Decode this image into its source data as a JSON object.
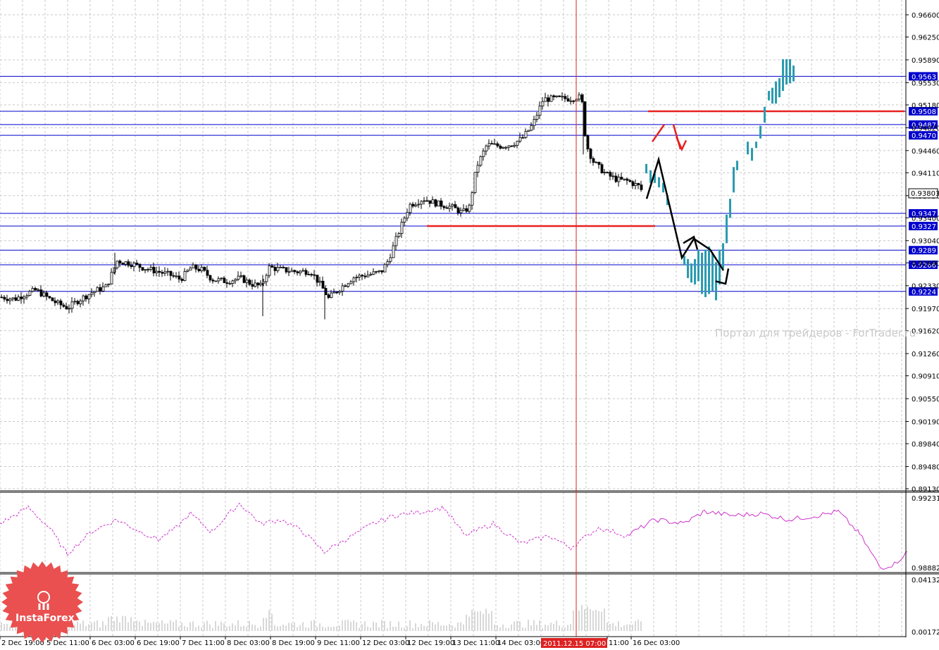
{
  "watermark": "Портал для трейдеров - ForTrader.ru",
  "brand": {
    "name": "InstaForex",
    "color": "#e9504f"
  },
  "current_price": "0.93803",
  "cursor_time": "2011.12.15 07:00",
  "colors": {
    "support_resistance": "#0000cc",
    "forecast_line": "#e82020",
    "forecast_bars": "#2a9bb0",
    "zigzag": "#000000",
    "oscillator": "#cc33cc",
    "cursor": "#dd2222",
    "grid": "#c8c8c8"
  },
  "chart_data": [
    {
      "type": "candlestick",
      "panel": "price",
      "y_ticks": [
        "0.96600",
        "0.96250",
        "0.95890",
        "0.95530",
        "0.95180",
        "0.94820",
        "0.94460",
        "0.94110",
        "0.93750",
        "0.93400",
        "0.93040",
        "0.92690",
        "0.92330",
        "0.91970",
        "0.91620",
        "0.91260",
        "0.90910",
        "0.90550",
        "0.90190",
        "0.89840",
        "0.89480",
        "0.89130"
      ],
      "ylim": [
        0.8913,
        0.966
      ],
      "x_ticks": [
        "2 Dec 19:00",
        "5 Dec 11:00",
        "6 Dec 03:00",
        "6 Dec 19:00",
        "7 Dec 11:00",
        "8 Dec 03:00",
        "8 Dec 19:00",
        "9 Dec 11:00",
        "12 Dec 03:00",
        "12 Dec 19:00",
        "13 Dec 11:00",
        "14 Dec 03:00",
        "11:00",
        "16 Dec 03:00"
      ],
      "levels": [
        {
          "label": "0.9563",
          "value": 0.9563
        },
        {
          "label": "0.9508",
          "value": 0.9508
        },
        {
          "label": "0.9487",
          "value": 0.9487
        },
        {
          "label": "0.9470",
          "value": 0.947
        },
        {
          "label": "0.9347",
          "value": 0.9347
        },
        {
          "label": "0.9327",
          "value": 0.9327
        },
        {
          "label": "0.9289",
          "value": 0.9289
        },
        {
          "label": "0.9266",
          "value": 0.9266
        },
        {
          "label": "0.9224",
          "value": 0.9224
        }
      ],
      "price_path": [
        [
          0,
          0.9215
        ],
        [
          20,
          0.9212
        ],
        [
          35,
          0.922
        ],
        [
          50,
          0.9226
        ],
        [
          65,
          0.9215
        ],
        [
          80,
          0.9205
        ],
        [
          95,
          0.9198
        ],
        [
          110,
          0.921
        ],
        [
          130,
          0.9223
        ],
        [
          150,
          0.9232
        ],
        [
          165,
          0.9272
        ],
        [
          185,
          0.9268
        ],
        [
          200,
          0.9262
        ],
        [
          220,
          0.9256
        ],
        [
          240,
          0.925
        ],
        [
          255,
          0.9243
        ],
        [
          270,
          0.9262
        ],
        [
          285,
          0.9258
        ],
        [
          300,
          0.9243
        ],
        [
          320,
          0.924
        ],
        [
          340,
          0.9245
        ],
        [
          355,
          0.9236
        ],
        [
          370,
          0.9232
        ],
        [
          380,
          0.9262
        ],
        [
          400,
          0.9258
        ],
        [
          420,
          0.9255
        ],
        [
          440,
          0.9256
        ],
        [
          455,
          0.9232
        ],
        [
          465,
          0.9213
        ],
        [
          480,
          0.9228
        ],
        [
          500,
          0.9246
        ],
        [
          520,
          0.925
        ],
        [
          540,
          0.9255
        ],
        [
          550,
          0.9273
        ],
        [
          565,
          0.9318
        ],
        [
          580,
          0.936
        ],
        [
          600,
          0.937
        ],
        [
          620,
          0.9362
        ],
        [
          640,
          0.9357
        ],
        [
          655,
          0.9348
        ],
        [
          665,
          0.9357
        ],
        [
          675,
          0.942
        ],
        [
          690,
          0.9455
        ],
        [
          710,
          0.9453
        ],
        [
          725,
          0.9456
        ],
        [
          740,
          0.9465
        ],
        [
          755,
          0.9487
        ],
        [
          770,
          0.9527
        ],
        [
          790,
          0.9528
        ],
        [
          810,
          0.9528
        ],
        [
          820,
          0.9532
        ],
        [
          826,
          0.9518
        ],
        [
          830,
          0.9458
        ],
        [
          840,
          0.943
        ],
        [
          850,
          0.9418
        ],
        [
          860,
          0.9408
        ],
        [
          875,
          0.94
        ],
        [
          890,
          0.9398
        ],
        [
          905,
          0.939
        ],
        [
          912,
          0.938
        ]
      ],
      "forecast_bars": [
        [
          916,
          0.941,
          0.9425
        ],
        [
          922,
          0.9395,
          0.9415
        ],
        [
          928,
          0.9395,
          0.941
        ],
        [
          934,
          0.9388,
          0.9404
        ],
        [
          940,
          0.938,
          0.9395
        ],
        [
          946,
          0.936,
          0.9375
        ],
        [
          970,
          0.9265,
          0.928
        ],
        [
          975,
          0.9245,
          0.9275
        ],
        [
          980,
          0.9238,
          0.9268
        ],
        [
          985,
          0.9235,
          0.9275
        ],
        [
          990,
          0.924,
          0.929
        ],
        [
          995,
          0.922,
          0.9285
        ],
        [
          1000,
          0.9215,
          0.929
        ],
        [
          1005,
          0.922,
          0.9295
        ],
        [
          1010,
          0.9225,
          0.9285
        ],
        [
          1015,
          0.921,
          0.927
        ],
        [
          1020,
          0.9235,
          0.929
        ],
        [
          1025,
          0.926,
          0.93
        ],
        [
          1030,
          0.93,
          0.9345
        ],
        [
          1035,
          0.934,
          0.937
        ],
        [
          1040,
          0.938,
          0.942
        ],
        [
          1045,
          0.9415,
          0.943
        ],
        [
          1060,
          0.944,
          0.946
        ],
        [
          1066,
          0.943,
          0.945
        ],
        [
          1072,
          0.945,
          0.946
        ],
        [
          1078,
          0.9465,
          0.9485
        ],
        [
          1084,
          0.949,
          0.9515
        ],
        [
          1090,
          0.9525,
          0.954
        ],
        [
          1095,
          0.952,
          0.9545
        ],
        [
          1100,
          0.952,
          0.9555
        ],
        [
          1105,
          0.953,
          0.956
        ],
        [
          1110,
          0.954,
          0.959
        ],
        [
          1115,
          0.955,
          0.959
        ],
        [
          1120,
          0.9552,
          0.959
        ],
        [
          1125,
          0.9555,
          0.958
        ]
      ],
      "forecast_lines": [
        {
          "from": [
            606,
            0.9327
          ],
          "to": [
            930,
            0.9327
          ]
        },
        {
          "from": [
            920,
            0.9508
          ],
          "to": [
            1284,
            0.9508
          ]
        }
      ],
      "zigzag": [
        [
          918,
          0.937
        ],
        [
          935,
          0.9432
        ],
        [
          968,
          0.9277
        ],
        [
          985,
          0.9307
        ],
        [
          1008,
          0.929
        ],
        [
          1027,
          0.9257
        ]
      ],
      "annotations": "red forecast arrows near 16 Dec"
    },
    {
      "type": "line",
      "panel": "oscillator",
      "y_ticks": [
        "0.99231",
        "0.98882"
      ],
      "ylim": [
        0.98882,
        0.99231
      ],
      "values_dashed_x": [
        0,
        40,
        70,
        95,
        130,
        165,
        200,
        225,
        250,
        270,
        300,
        340,
        370,
        400,
        430,
        460,
        490,
        530,
        560,
        600,
        630,
        660,
        700,
        740,
        780,
        810,
        850,
        890
      ],
      "values_dashed_y": [
        0.991,
        0.9918,
        0.9908,
        0.9895,
        0.9906,
        0.9912,
        0.9906,
        0.9902,
        0.9908,
        0.9915,
        0.9906,
        0.992,
        0.991,
        0.9912,
        0.9906,
        0.9896,
        0.9902,
        0.991,
        0.9914,
        0.9916,
        0.9918,
        0.9904,
        0.991,
        0.99,
        0.9904,
        0.9898,
        0.9908,
        0.9904
      ],
      "values_solid_x": [
        890,
        930,
        970,
        1000,
        1040,
        1080,
        1120,
        1160,
        1190,
        1220,
        1250,
        1270,
        1288
      ],
      "values_solid_y": [
        0.9904,
        0.9912,
        0.991,
        0.9916,
        0.9914,
        0.9915,
        0.9912,
        0.9914,
        0.9916,
        0.9905,
        0.9888,
        0.989,
        0.9896
      ]
    },
    {
      "type": "bar",
      "panel": "volume",
      "y_ticks": [
        "0.04132",
        "0.00172"
      ],
      "ylim": [
        0.0,
        0.04132
      ]
    }
  ]
}
